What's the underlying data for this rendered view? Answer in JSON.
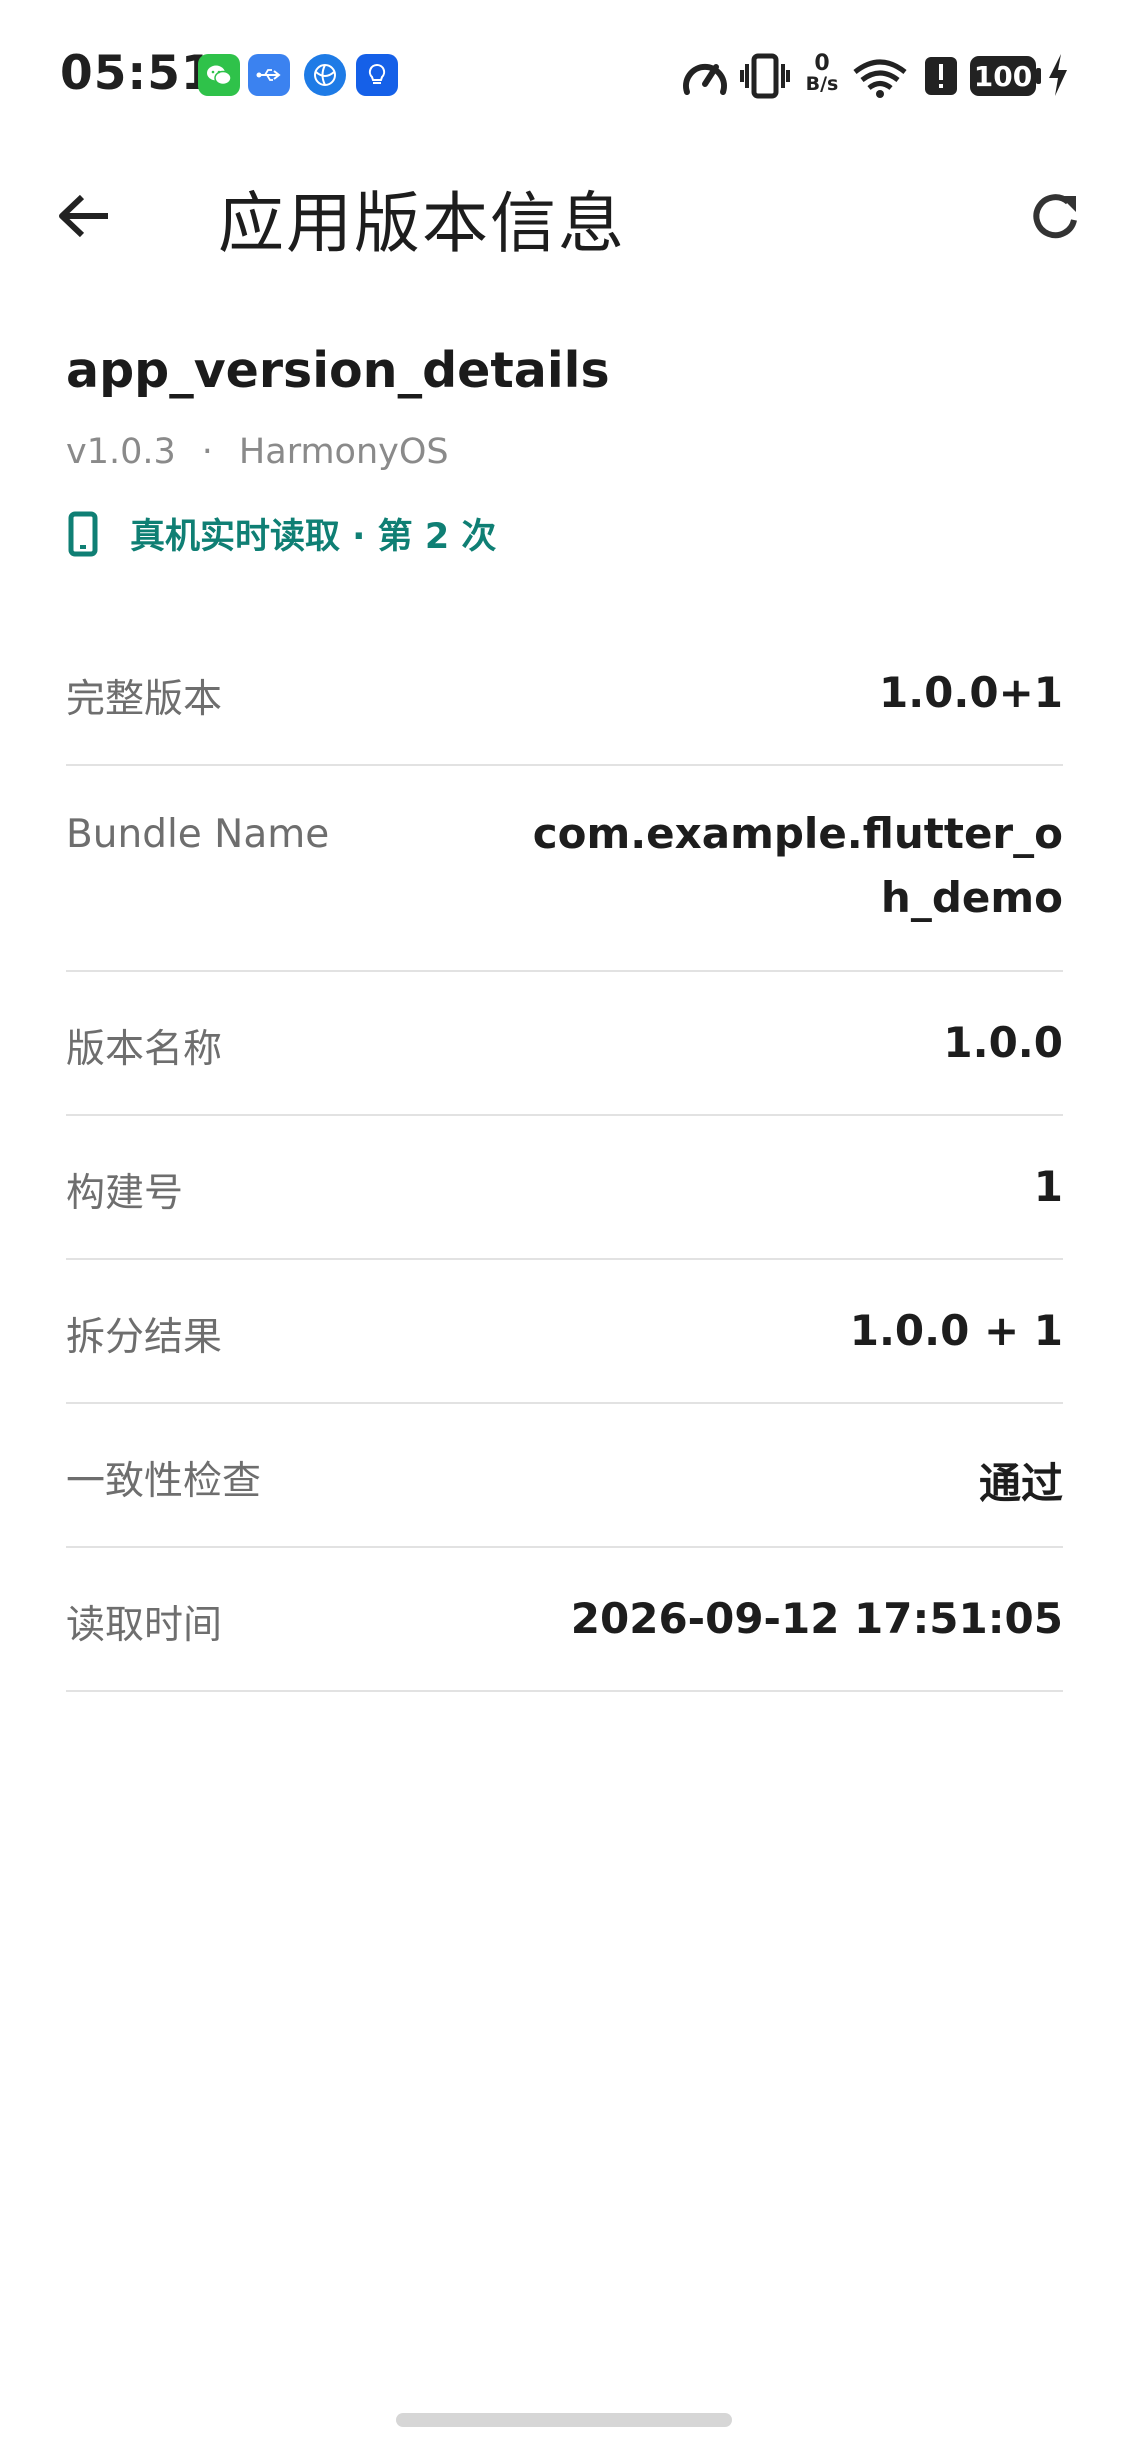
{
  "status_bar": {
    "time": "05:51",
    "network_speed_value": "0",
    "network_speed_unit": "B/s",
    "battery": "100",
    "notification_icons": [
      "wechat-icon",
      "usb-icon",
      "browser-icon",
      "lightbulb-icon"
    ],
    "system_icons": [
      "speedometer-icon",
      "vibrate-icon",
      "wifi-icon",
      "alert-icon",
      "battery-icon",
      "charging-icon"
    ]
  },
  "app_bar": {
    "title": "应用版本信息",
    "back_icon": "arrow-back-icon",
    "refresh_icon": "refresh-icon"
  },
  "header": {
    "app_name": "app_version_details",
    "version": "v1.0.3",
    "separator": "·",
    "platform": "HarmonyOS",
    "live_status": "真机实时读取 · 第 2 次",
    "accent_color": "#0f7f74"
  },
  "details": [
    {
      "label": "完整版本",
      "value": "1.0.0+1"
    },
    {
      "label": "Bundle Name",
      "value": "com.example.flutter_oh_demo"
    },
    {
      "label": "版本名称",
      "value": "1.0.0"
    },
    {
      "label": "构建号",
      "value": "1"
    },
    {
      "label": "拆分结果",
      "value": "1.0.0 + 1"
    },
    {
      "label": "一致性检查",
      "value": "通过"
    },
    {
      "label": "读取时间",
      "value": "2026-09-12 17:51:05"
    }
  ]
}
